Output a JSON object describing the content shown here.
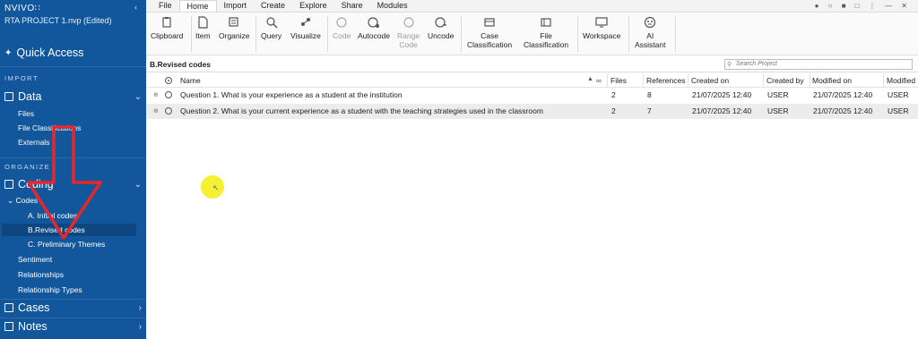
{
  "sidebar": {
    "brand": "NVIVO∷",
    "project": "RTA PROJECT 1.nvp (Edited)",
    "quick_access": "Quick Access",
    "section_import": "IMPORT",
    "data": {
      "label": "Data",
      "items": [
        "Files",
        "File Classifications",
        "Externals"
      ]
    },
    "section_organize": "ORGANIZE",
    "coding": {
      "label": "Coding",
      "codes_label": "Codes",
      "codes": [
        "A. Initial codes",
        "B.Revised codes",
        "C. Preliminary Themes"
      ],
      "items": [
        "Sentiment",
        "Relationships",
        "Relationship Types"
      ]
    },
    "cases": "Cases",
    "notes": "Notes",
    "colors": {
      "background": "#12569b",
      "selected": "#0e467f"
    }
  },
  "tabs": [
    "File",
    "Home",
    "Import",
    "Create",
    "Explore",
    "Share",
    "Modules"
  ],
  "active_tab": "Home",
  "ribbon": {
    "clipboard": "Clipboard",
    "item": "Item",
    "organize": "Organize",
    "query": "Query",
    "visualize": "Visualize",
    "code": "Code",
    "autocode": "Autocode",
    "range_code": [
      "Range",
      "Code"
    ],
    "uncode": "Uncode",
    "case_classification": [
      "Case",
      "Classification"
    ],
    "file_classification": [
      "File",
      "Classification"
    ],
    "workspace": "Workspace",
    "ai_assistant": [
      "AI",
      "Assistant"
    ]
  },
  "content": {
    "breadcrumb": "B.Revised codes",
    "search_placeholder": "Search Project",
    "columns": [
      "Name",
      "Files",
      "References",
      "Created on",
      "Created by",
      "Modified on",
      "Modified"
    ],
    "rows": [
      {
        "name": "Question 1. What is your experience as a student at the institution",
        "files": "2",
        "references": "8",
        "created_on": "21/07/2025 12:40",
        "created_by": "USER",
        "modified_on": "21/07/2025 12:40",
        "modified_by": "USER"
      },
      {
        "name": "Question 2. What is your current experience as a student with the teaching strategies used in the classroom",
        "files": "2",
        "references": "7",
        "created_on": "21/07/2025 12:40",
        "created_by": "USER",
        "modified_on": "21/07/2025 12:40",
        "modified_by": "USER"
      }
    ]
  },
  "annotation": {
    "arrow_color": "#e8262b",
    "highlight_color": "#f4ef1c"
  }
}
